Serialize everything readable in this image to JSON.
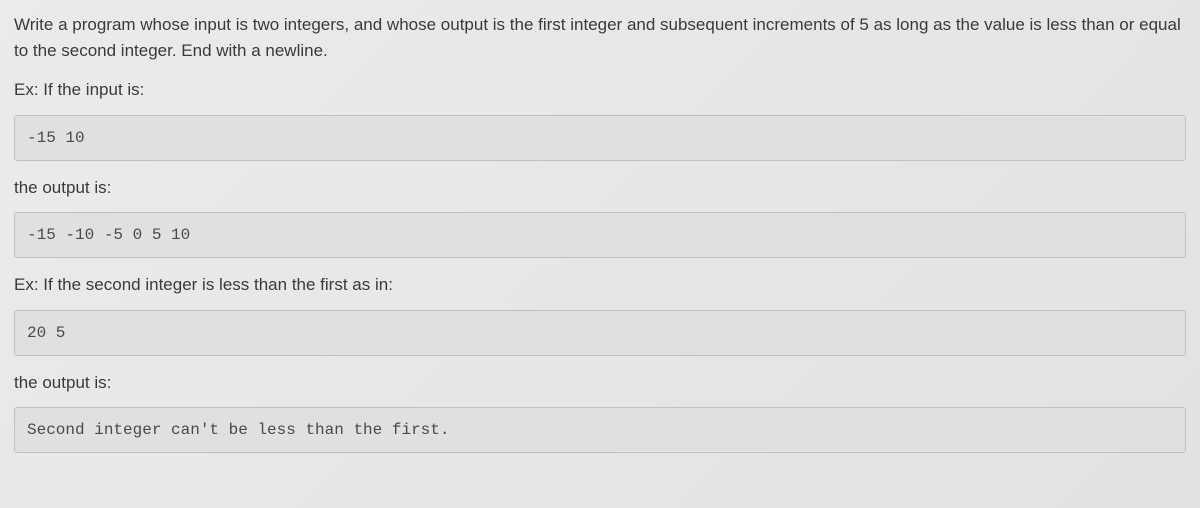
{
  "problem": {
    "description": "Write a program whose input is two integers, and whose output is the first integer and subsequent increments of 5 as long as the value is less than or equal to the second integer. End with a newline."
  },
  "example1": {
    "input_label": "Ex: If the input is:",
    "input_code": "-15 10",
    "output_label": "the output is:",
    "output_code": "-15 -10 -5 0 5 10"
  },
  "example2": {
    "input_label": "Ex: If the second integer is less than the first as in:",
    "input_code": "20 5",
    "output_label": "the output is:",
    "output_code": "Second integer can't be less than the first."
  }
}
